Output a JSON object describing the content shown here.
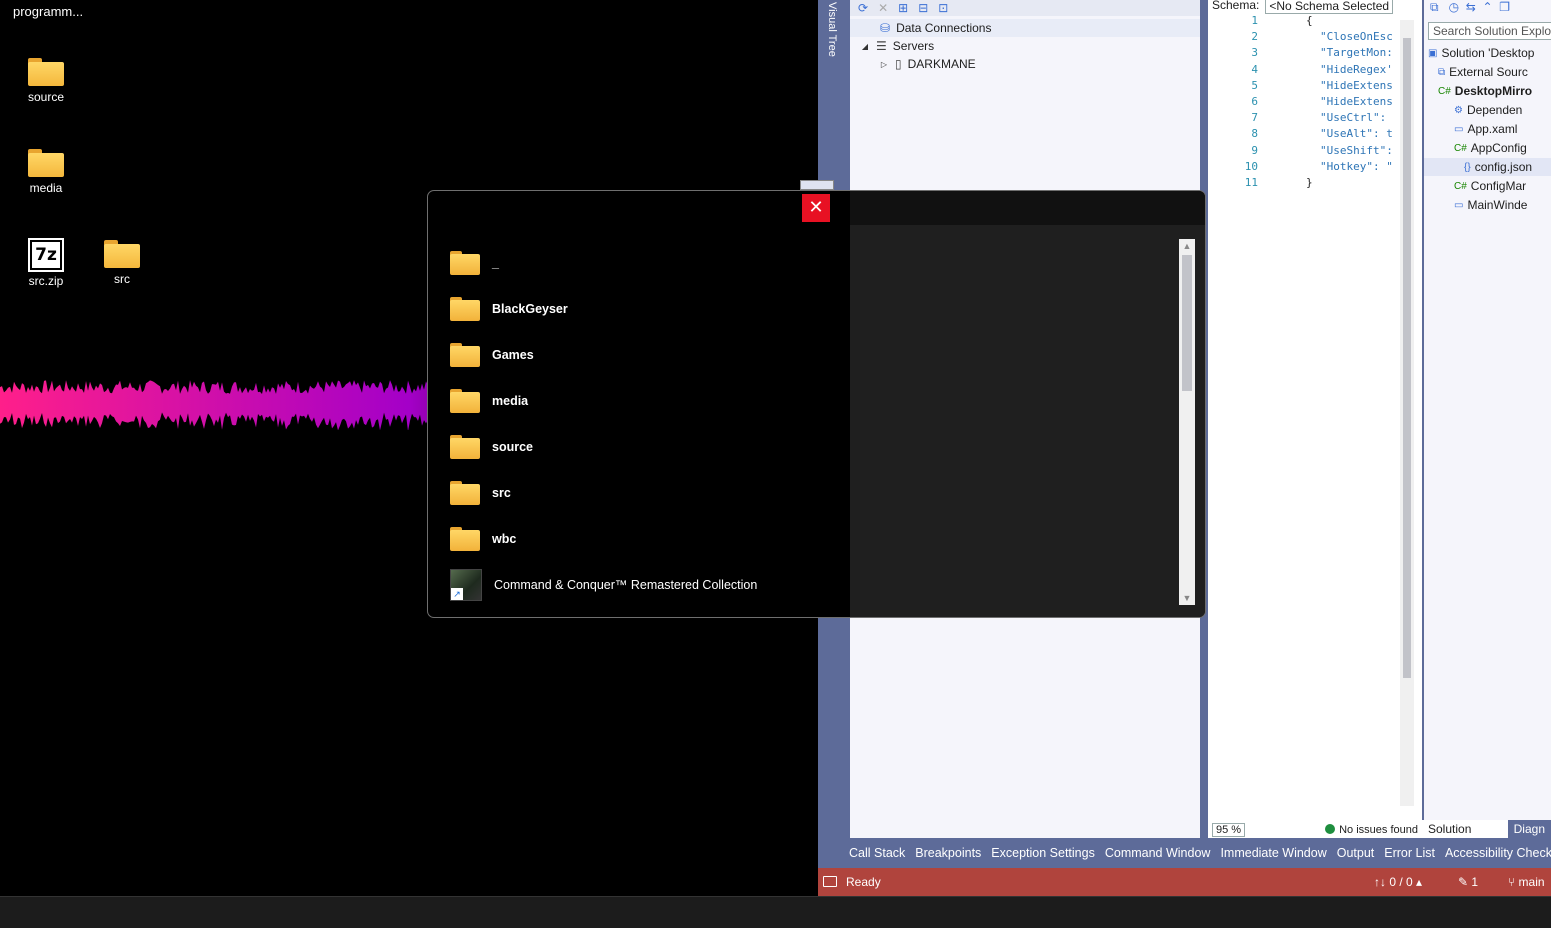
{
  "desktop": {
    "top_label": "programm...",
    "icons": [
      {
        "label": "source",
        "type": "folder"
      },
      {
        "label": "media",
        "type": "folder"
      },
      {
        "label": "src.zip",
        "type": "zip",
        "glyph": "7z"
      },
      {
        "label": "src",
        "type": "folder"
      }
    ]
  },
  "launcher": {
    "close_glyph": "✕",
    "items": [
      {
        "label": "_",
        "type": "folder"
      },
      {
        "label": "BlackGeyser",
        "type": "folder"
      },
      {
        "label": "Games",
        "type": "folder"
      },
      {
        "label": "media",
        "type": "folder"
      },
      {
        "label": "source",
        "type": "folder"
      },
      {
        "label": "src",
        "type": "folder"
      },
      {
        "label": "wbc",
        "type": "folder"
      },
      {
        "label": "Command & Conquer™ Remastered Collection",
        "type": "shortcut"
      }
    ]
  },
  "vs": {
    "side_tab": "Visual Tree",
    "server_explorer": {
      "rows": [
        {
          "label": "Data Connections"
        },
        {
          "label": "Servers",
          "expander": "◢"
        },
        {
          "label": "DARKMANE",
          "expander": "▷"
        }
      ]
    },
    "editor": {
      "schema_label": "Schema:",
      "schema_value": "<No Schema Selected",
      "lines": [
        {
          "n": "1",
          "text": "{"
        },
        {
          "n": "2",
          "text": "\"CloseOnEsc"
        },
        {
          "n": "3",
          "text": "\"TargetMon:"
        },
        {
          "n": "4",
          "text": "\"HideRegex'"
        },
        {
          "n": "5",
          "text": "\"HideExtens"
        },
        {
          "n": "6",
          "text": "\"HideExtens"
        },
        {
          "n": "7",
          "text": "\"UseCtrl\":"
        },
        {
          "n": "8",
          "text": "\"UseAlt\": t"
        },
        {
          "n": "9",
          "text": "\"UseShift\":"
        },
        {
          "n": "10",
          "text": "\"Hotkey\": \""
        },
        {
          "n": "11",
          "text": "}"
        }
      ],
      "zoom": "95 %",
      "issues": "No issues found"
    },
    "solution_explorer": {
      "search_placeholder": "Search Solution Explore",
      "rows": [
        {
          "label": "Solution 'Desktop"
        },
        {
          "label": "External Sourc"
        },
        {
          "label": "DesktopMirro"
        },
        {
          "label": "Dependen"
        },
        {
          "label": "App.xaml"
        },
        {
          "label": "AppConfig"
        },
        {
          "label": "config.json"
        },
        {
          "label": "ConfigMar"
        },
        {
          "label": "MainWinde"
        }
      ],
      "tabs": [
        "Solution Expl...",
        "Diagn"
      ]
    },
    "bottom_tabs": [
      "Call Stack",
      "Breakpoints",
      "Exception Settings",
      "Command Window",
      "Immediate Window",
      "Output",
      "Error List",
      "Accessibility Checker"
    ],
    "status": {
      "ready": "Ready",
      "sync": "↑↓ 0 / 0 ▴",
      "edits": "✎ 1",
      "branch": "main"
    }
  },
  "colors": {
    "vs_accent": "#5d6b99",
    "status_bar": "#b0443d",
    "close_red": "#e81123",
    "waveform_start": "#ff1f8a",
    "waveform_end": "#a400c8"
  }
}
